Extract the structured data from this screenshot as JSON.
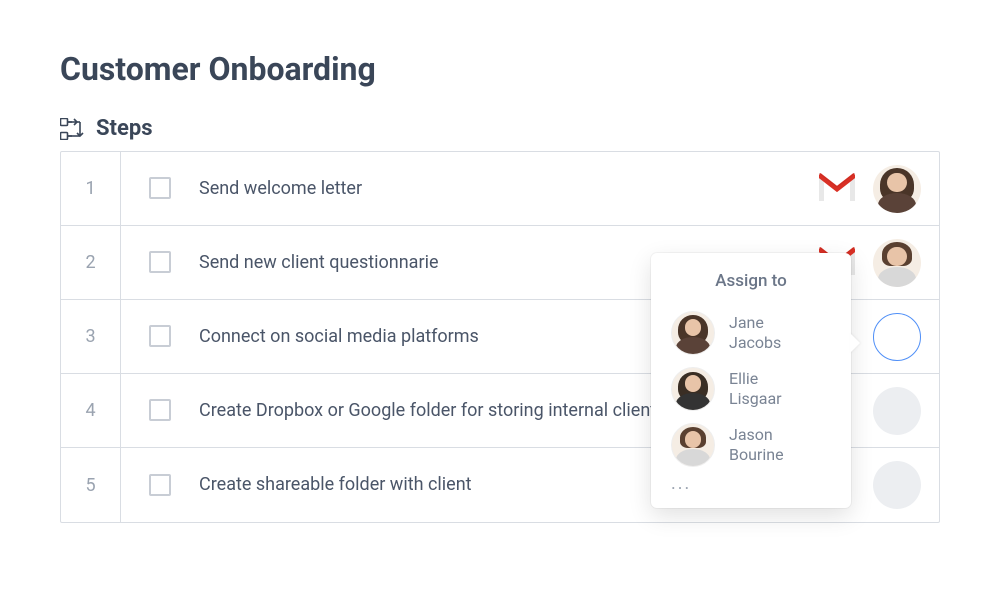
{
  "title": "Customer Onboarding",
  "section": {
    "label": "Steps",
    "icon": "steps-icon"
  },
  "steps": [
    {
      "num": "1",
      "label": "Send welcome letter",
      "app": "gmail",
      "assignee": "jane",
      "avatarState": "filled"
    },
    {
      "num": "2",
      "label": "Send new client questionnarie",
      "app": "gmail",
      "assignee": "jason",
      "avatarState": "filled"
    },
    {
      "num": "3",
      "label": "Connect on social media platforms",
      "app": null,
      "assignee": null,
      "avatarState": "selected"
    },
    {
      "num": "4",
      "label": "Create Dropbox or Google folder for storing internal client documents",
      "app": null,
      "assignee": null,
      "avatarState": "empty"
    },
    {
      "num": "5",
      "label": "Create shareable folder with client",
      "app": null,
      "assignee": null,
      "avatarState": "empty"
    }
  ],
  "assignPopover": {
    "title": "Assign to",
    "anchorStepIndex": 2,
    "people": [
      {
        "id": "jane",
        "name": "Jane Jacobs"
      },
      {
        "id": "ellie",
        "name": "Ellie Lisgaar"
      },
      {
        "id": "jason",
        "name": "Jason Bourine"
      }
    ],
    "more": "..."
  },
  "colors": {
    "text": "#3a4658",
    "muted": "#9aa3b0",
    "border": "#d9dde3",
    "accent": "#4f8ff7",
    "gmailRed": "#d93025"
  }
}
